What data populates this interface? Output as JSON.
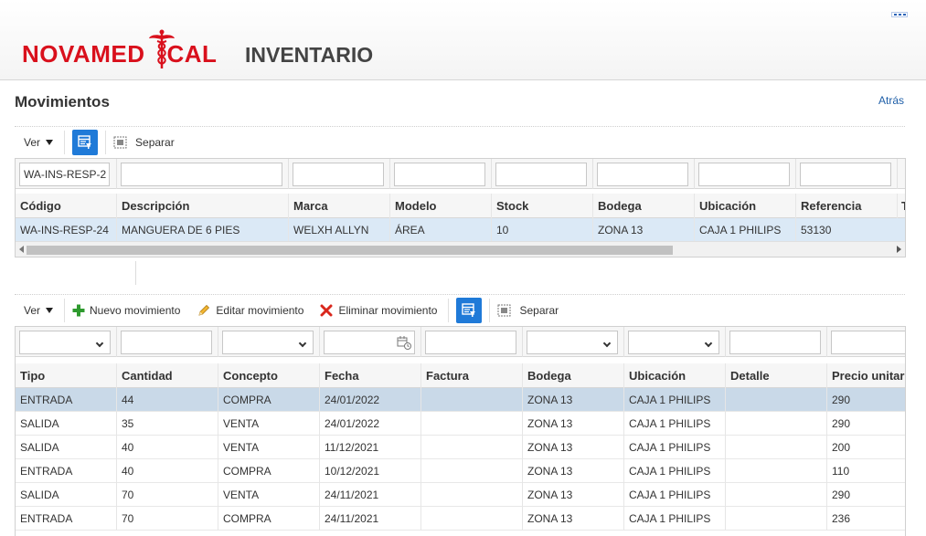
{
  "header": {
    "logo_left": "NOVAMED",
    "logo_right": "CAL",
    "app_title": "INVENTARIO",
    "brand_color": "#d9101c"
  },
  "page": {
    "title": "Movimientos",
    "back_label": "Atrás"
  },
  "products": {
    "toolbar": {
      "view_label": "Ver",
      "detach_label": "Separar"
    },
    "filters": [
      "WA-INS-RESP-2",
      "",
      "",
      "",
      "",
      "",
      "",
      ""
    ],
    "columns": [
      "Código",
      "Descripción",
      "Marca",
      "Modelo",
      "Stock",
      "Bodega",
      "Ubicación",
      "Referencia",
      "T"
    ],
    "rows": [
      [
        "WA-INS-RESP-24",
        "MANGUERA DE 6 PIES",
        "WELXH ALLYN",
        "ÁREA",
        "10",
        "ZONA 13",
        "CAJA 1 PHILIPS",
        "53130"
      ]
    ]
  },
  "movements": {
    "toolbar": {
      "view_label": "Ver",
      "new_label": "Nuevo movimiento",
      "edit_label": "Editar movimiento",
      "delete_label": "Eliminar movimiento",
      "detach_label": "Separar"
    },
    "columns": [
      "Tipo",
      "Cantidad",
      "Concepto",
      "Fecha",
      "Factura",
      "Bodega",
      "Ubicación",
      "Detalle",
      "Precio unitar"
    ],
    "rows": [
      [
        "ENTRADA",
        "44",
        "COMPRA",
        "24/01/2022",
        "",
        "ZONA 13",
        "CAJA 1 PHILIPS",
        "",
        "290"
      ],
      [
        "SALIDA",
        "35",
        "VENTA",
        "24/01/2022",
        "",
        "ZONA 13",
        "CAJA 1 PHILIPS",
        "",
        "290"
      ],
      [
        "SALIDA",
        "40",
        "VENTA",
        "11/12/2021",
        "",
        "ZONA 13",
        "CAJA 1 PHILIPS",
        "",
        "200"
      ],
      [
        "ENTRADA",
        "40",
        "COMPRA",
        "10/12/2021",
        "",
        "ZONA 13",
        "CAJA 1 PHILIPS",
        "",
        "110"
      ],
      [
        "SALIDA",
        "70",
        "VENTA",
        "24/11/2021",
        "",
        "ZONA 13",
        "CAJA 1 PHILIPS",
        "",
        "290"
      ],
      [
        "ENTRADA",
        "70",
        "COMPRA",
        "24/11/2021",
        "",
        "ZONA 13",
        "CAJA 1 PHILIPS",
        "",
        "236"
      ]
    ]
  }
}
